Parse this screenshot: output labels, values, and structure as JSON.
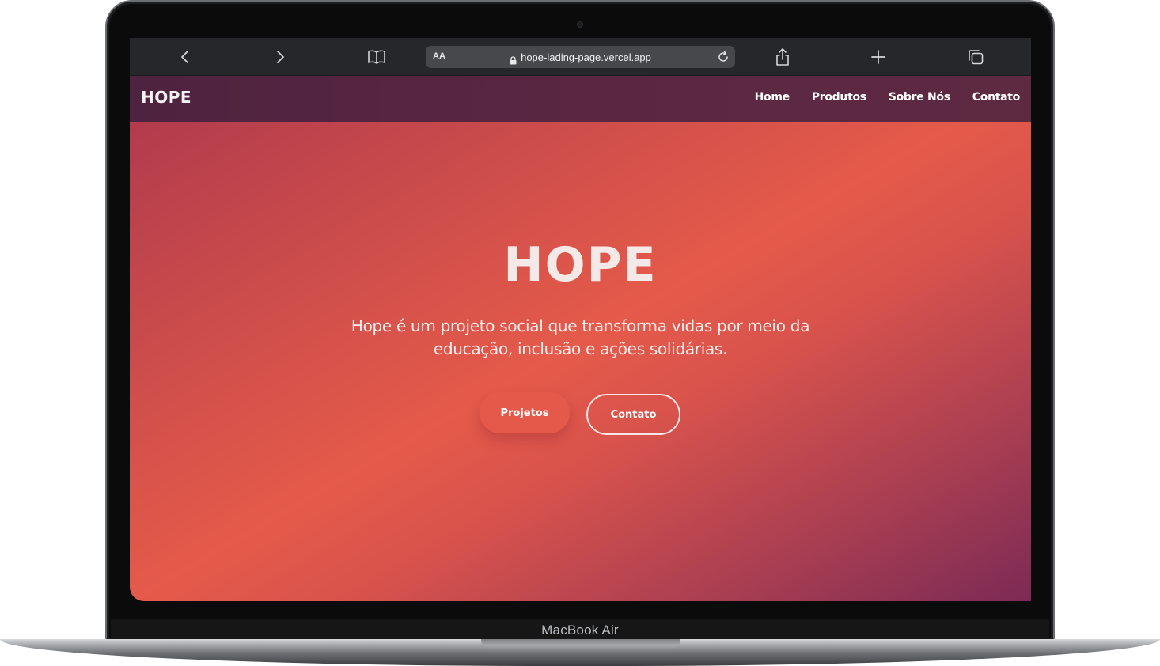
{
  "device": {
    "label": "MacBook Air"
  },
  "browser": {
    "address_bar": {
      "text_size_label": "AA",
      "url": "hope-lading-page.vercel.app"
    },
    "icons": [
      "back-icon",
      "forward-icon",
      "bookmarks-icon",
      "lock-icon",
      "reload-icon",
      "share-icon",
      "new-tab-icon",
      "tabs-icon"
    ]
  },
  "site": {
    "brand": "HOPE",
    "nav": [
      "Home",
      "Produtos",
      "Sobre Nós",
      "Contato"
    ],
    "hero": {
      "title": "HOPE",
      "text": "Hope é um projeto social que transforma vidas por meio da educação, inclusão e ações solidárias.",
      "primary_button": "Projetos",
      "secondary_button": "Contato"
    },
    "colors": {
      "header": "#582541",
      "accent": "#e5594a",
      "gradient_start": "#b23b4c",
      "gradient_end": "#7c2a55"
    }
  }
}
